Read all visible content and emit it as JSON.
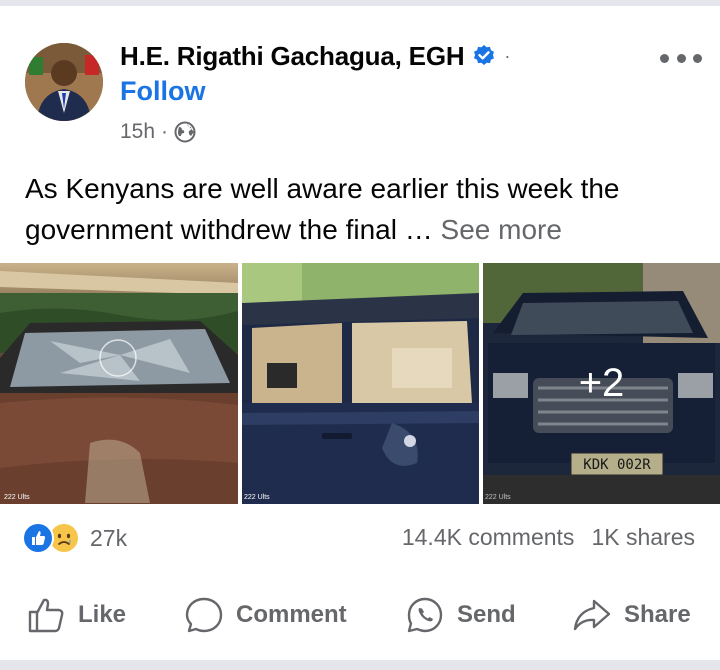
{
  "post": {
    "author": "H.E. Rigathi Gachagua, EGH",
    "follow_label": "Follow",
    "time": "15h",
    "meta_separator": "·",
    "header_separator": "·",
    "text": "As Kenyans are well aware earlier this week the government withdrew the final … ",
    "see_more": "See more",
    "icons": {
      "verified": "verified-badge-icon",
      "audience": "globe-icon",
      "menu": "more-options-icon"
    }
  },
  "photos": {
    "items": [
      {
        "caption_tag": "222 Ults"
      },
      {
        "caption_tag": "222 Ults"
      },
      {
        "caption_tag": "222 Ults",
        "plate": "KDK 002R",
        "more_count": "+2"
      }
    ]
  },
  "engagement": {
    "reaction_count": "27k",
    "comments": "14.4K comments",
    "shares": "1K shares",
    "reaction_icons": [
      "like-reaction-icon",
      "sad-reaction-icon"
    ]
  },
  "actions": {
    "like": "Like",
    "comment": "Comment",
    "send": "Send",
    "share": "Share"
  },
  "colors": {
    "accent": "#1b74e4",
    "secondary_text": "#65676b",
    "divider": "#e4e6eb"
  }
}
